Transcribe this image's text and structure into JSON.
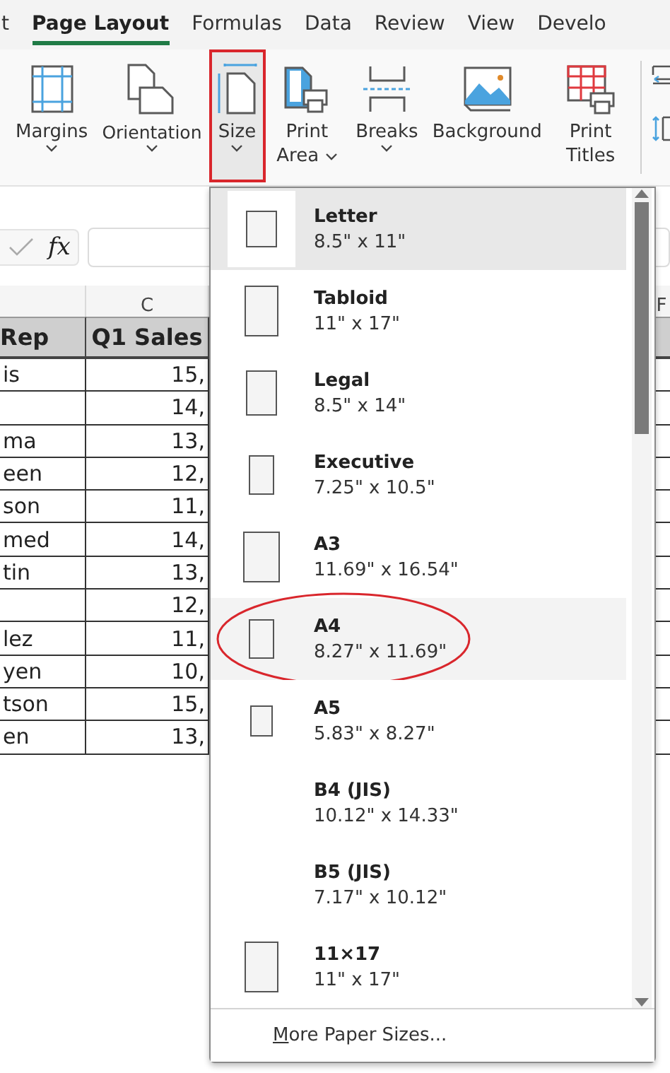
{
  "tabs": [
    {
      "label": "t",
      "selected": false
    },
    {
      "label": "Page Layout",
      "selected": true
    },
    {
      "label": "Formulas",
      "selected": false
    },
    {
      "label": "Data",
      "selected": false
    },
    {
      "label": "Review",
      "selected": false
    },
    {
      "label": "View",
      "selected": false
    },
    {
      "label": "Develo",
      "selected": false
    }
  ],
  "ribbon_buttons": [
    {
      "kind": "margins",
      "label": "Margins",
      "dropdown": true,
      "callout": false
    },
    {
      "kind": "orientation",
      "label": "Orientation",
      "dropdown": true,
      "callout": false
    },
    {
      "kind": "size",
      "label": "Size",
      "dropdown": true,
      "callout": true
    },
    {
      "kind": "print_area",
      "label": "Print Area",
      "dropdown": true,
      "callout": false
    },
    {
      "kind": "breaks",
      "label": "Breaks",
      "dropdown": true,
      "callout": false
    },
    {
      "kind": "background",
      "label": "Background",
      "dropdown": false,
      "callout": false
    },
    {
      "kind": "print_titles",
      "label": "Print Titles",
      "dropdown": false,
      "callout": false
    }
  ],
  "formula_bar": {
    "function_label": "fx"
  },
  "sheet": {
    "column_letters": [
      "C",
      "F"
    ],
    "headers": [
      "Rep",
      "Q1 Sales"
    ],
    "rows": [
      [
        "is",
        "15,"
      ],
      [
        "",
        "14,"
      ],
      [
        "ma",
        "13,"
      ],
      [
        "een",
        "12,"
      ],
      [
        "son",
        "11,"
      ],
      [
        "med",
        "14,"
      ],
      [
        "tin",
        "13,"
      ],
      [
        "",
        "12,"
      ],
      [
        "lez",
        "11,"
      ],
      [
        "yen",
        "10,"
      ],
      [
        "tson",
        "15,"
      ],
      [
        "en",
        "13,"
      ]
    ]
  },
  "size_menu": {
    "items": [
      {
        "name": "Letter",
        "dims": "8.5\" x 11\"",
        "kind": "page",
        "selected": true,
        "hovered": false,
        "callout": false
      },
      {
        "name": "Tabloid",
        "dims": "11\" x 17\"",
        "kind": "page",
        "selected": false,
        "hovered": false,
        "callout": false
      },
      {
        "name": "Legal",
        "dims": "8.5\" x 14\"",
        "kind": "page",
        "selected": false,
        "hovered": false,
        "callout": false
      },
      {
        "name": "Executive",
        "dims": "7.25\" x 10.5\"",
        "kind": "page",
        "selected": false,
        "hovered": false,
        "callout": false
      },
      {
        "name": "A3",
        "dims": "11.69\" x 16.54\"",
        "kind": "page",
        "selected": false,
        "hovered": false,
        "callout": false
      },
      {
        "name": "A4",
        "dims": "8.27\" x 11.69\"",
        "kind": "page",
        "selected": false,
        "hovered": true,
        "callout": true
      },
      {
        "name": "A5",
        "dims": "5.83\" x 8.27\"",
        "kind": "page",
        "selected": false,
        "hovered": false,
        "callout": false
      },
      {
        "name": "B4 (JIS)",
        "dims": "10.12\" x 14.33\"",
        "kind": "blank",
        "selected": false,
        "hovered": false,
        "callout": false
      },
      {
        "name": "B5 (JIS)",
        "dims": "7.17\" x 10.12\"",
        "kind": "blank",
        "selected": false,
        "hovered": false,
        "callout": false
      },
      {
        "name": "11×17",
        "dims": "11\" x 17\"",
        "kind": "page",
        "selected": false,
        "hovered": false,
        "callout": false
      }
    ],
    "more_link": "More Paper Sizes..."
  }
}
